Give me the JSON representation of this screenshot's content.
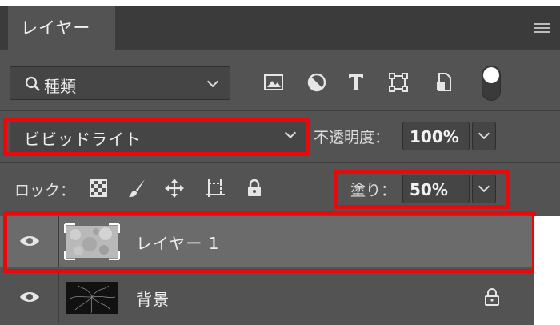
{
  "panel": {
    "tab_title": "レイヤー",
    "menu_icon": "hamburger-icon"
  },
  "filter": {
    "kind_label": "種類",
    "icons": [
      "image-filter-icon",
      "adjustment-filter-icon",
      "type-filter-icon",
      "shape-filter-icon",
      "smart-object-filter-icon"
    ],
    "toggle_on": true
  },
  "blend": {
    "mode": "ビビッドライト",
    "opacity_label": "不透明度：",
    "opacity_value": "100%"
  },
  "lock": {
    "label": "ロック：",
    "icons": [
      "lock-transparent-pixels-icon",
      "lock-image-pixels-icon",
      "lock-position-icon",
      "lock-artboard-icon",
      "lock-all-icon"
    ],
    "fill_label": "塗り：",
    "fill_value": "50%"
  },
  "layers": [
    {
      "name": "レイヤー 1",
      "visible": true,
      "selected": true,
      "locked": false
    },
    {
      "name": "背景",
      "visible": true,
      "selected": false,
      "locked": true
    }
  ],
  "highlight_color": "#e8090c"
}
